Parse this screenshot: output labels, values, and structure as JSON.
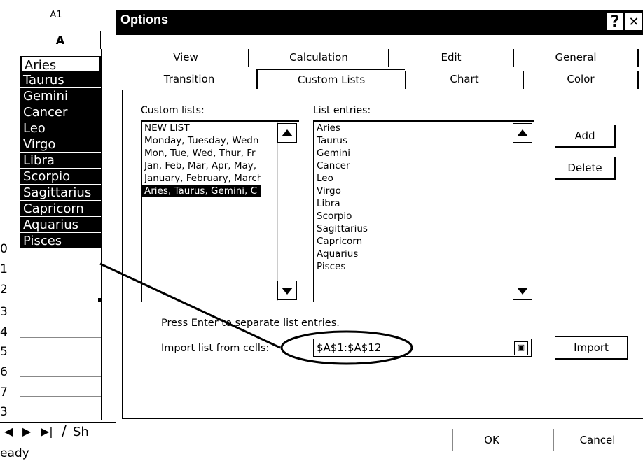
{
  "sheet": {
    "name_box": "A1",
    "column_header": "A",
    "cells": [
      "Aries",
      "Taurus",
      "Gemini",
      "Cancer",
      "Leo",
      "Virgo",
      "Libra",
      "Scorpio",
      "Sagittarius",
      "Capricorn",
      "Aquarius",
      "Pisces"
    ],
    "row_numbers": [
      "0",
      "1",
      "2",
      "3",
      "4",
      "5",
      "6",
      "7",
      "3"
    ],
    "sheet_tab": "Sh",
    "status": "eady"
  },
  "dialog": {
    "title": "Options",
    "help_button": "?",
    "close_button": "✕",
    "tabs_back": [
      "View",
      "Calculation",
      "Edit",
      "General"
    ],
    "tabs_front": [
      "Transition",
      "Custom Lists",
      "Chart",
      "Color"
    ],
    "active_tab": "Custom Lists",
    "custom_lists_label": "Custom lists:",
    "custom_lists": [
      "NEW LIST",
      "Monday, Tuesday, Wedn",
      "Mon, Tue, Wed, Thur, Fr",
      "Jan, Feb, Mar, Apr, May,",
      "January, February, March",
      "Aries, Taurus, Gemini, C"
    ],
    "selected_list_index": 5,
    "list_entries_label": "List entries:",
    "list_entries": [
      "Aries",
      "Taurus",
      "Gemini",
      "Cancer",
      "Leo",
      "Virgo",
      "Libra",
      "Scorpio",
      "Sagittarius",
      "Capricorn",
      "Aquarius",
      "Pisces"
    ],
    "add_button": "Add",
    "delete_button": "Delete",
    "hint": "Press Enter to separate list entries.",
    "import_label": "Import list from cells:",
    "import_value": "$A$1:$A$12",
    "import_button": "Import",
    "ok_button": "OK",
    "cancel_button": "Cancel"
  }
}
